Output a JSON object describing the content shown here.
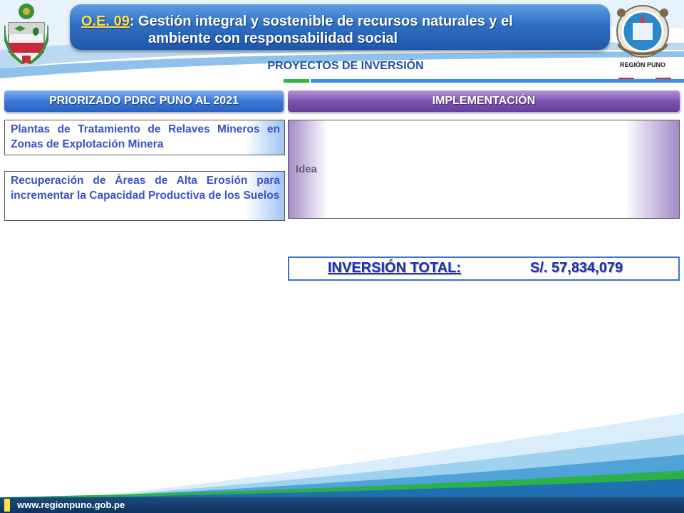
{
  "header": {
    "code": "O.E. 09",
    "colon": ":",
    "title_line1": " Gestión integral y sostenible de recursos naturales y el",
    "title_line2": "ambiente con responsabilidad social",
    "subtitle": "PROYECTOS DE INVERSIÓN",
    "region_logo_text": "REGIÓN PUNO"
  },
  "left_section": {
    "header": "PRIORIZADO  PDRC PUNO AL 2021",
    "projects": [
      "Plantas de Tratamiento de Relaves Mineros en Zonas de Explotación Minera",
      "Recuperación de Áreas de Alta Erosión para incrementar la Capacidad Productiva de los Suelos"
    ]
  },
  "right_section": {
    "header": "IMPLEMENTACIÓN",
    "stage": "Idea"
  },
  "total": {
    "label": "INVERSIÓN TOTAL:",
    "value": "S/. 57,834,079"
  },
  "footer": {
    "url": "www.regionpuno.gob.pe"
  },
  "colors": {
    "header_blue": "#2f6fc4",
    "left_header_blue": "#3d7ad8",
    "right_header_purple": "#7c53b0",
    "project_text": "#3b52c4",
    "total_text": "#1c2fb0",
    "footer_navy": "#0f3560"
  }
}
